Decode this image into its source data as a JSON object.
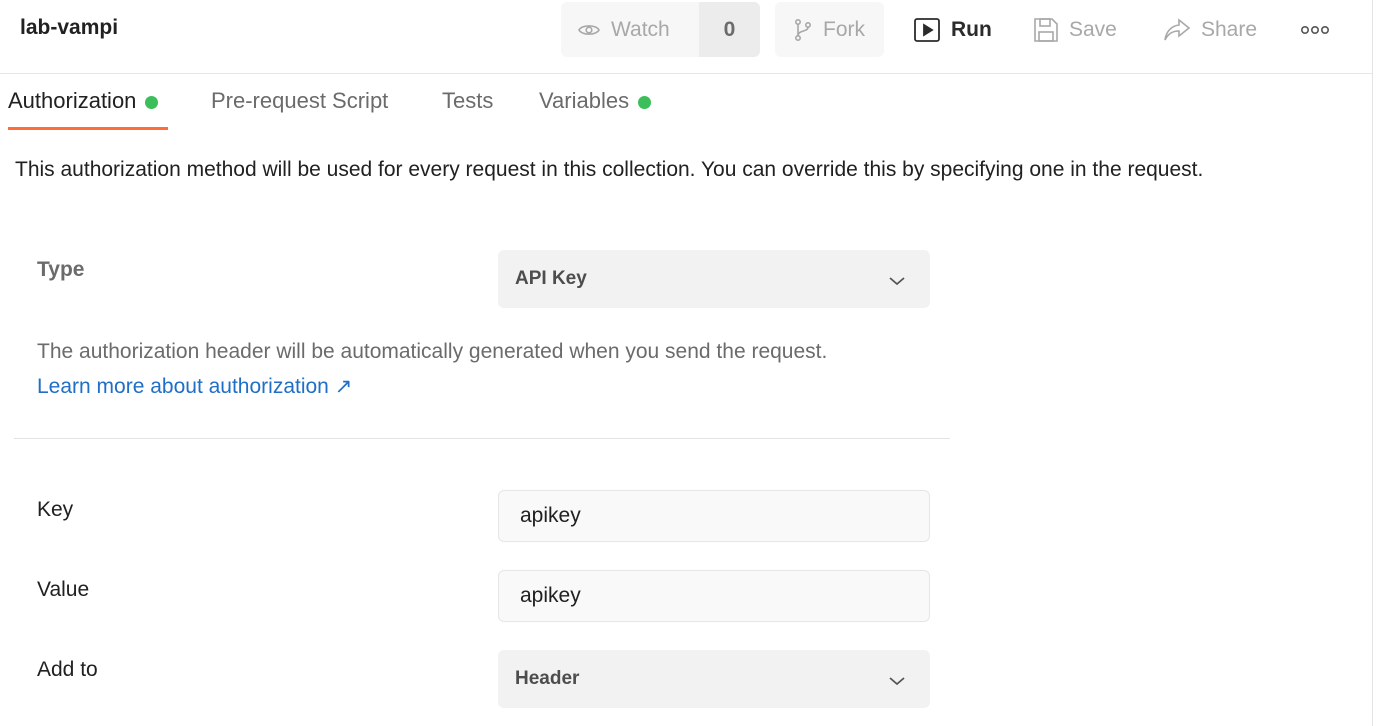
{
  "header": {
    "collection_title": "lab-vampi",
    "watch_label": "Watch",
    "watch_count": "0",
    "fork_label": "Fork",
    "run_label": "Run",
    "save_label": "Save",
    "share_label": "Share",
    "more_icon": "more-horizontal-icon"
  },
  "tabs": [
    {
      "label": "Authorization",
      "active": true,
      "has_dot": true
    },
    {
      "label": "Pre-request Script",
      "active": false,
      "has_dot": false
    },
    {
      "label": "Tests",
      "active": false,
      "has_dot": false
    },
    {
      "label": "Variables",
      "active": false,
      "has_dot": true
    }
  ],
  "auth": {
    "description": "This authorization method will be used for every request in this collection. You can override this by specifying one in the request.",
    "type_label": "Type",
    "type_value": "API Key",
    "helper_text": "The authorization header will be automatically generated when you send the request.",
    "learn_more": "Learn more about authorization ↗",
    "key_label": "Key",
    "key_value": "apikey",
    "value_label": "Value",
    "value_value": "apikey",
    "add_to_label": "Add to",
    "add_to_value": "Header"
  },
  "colors": {
    "accent_orange": "#ff6c37",
    "status_green": "#3cbe5a",
    "link_blue": "#1f6fc6"
  }
}
